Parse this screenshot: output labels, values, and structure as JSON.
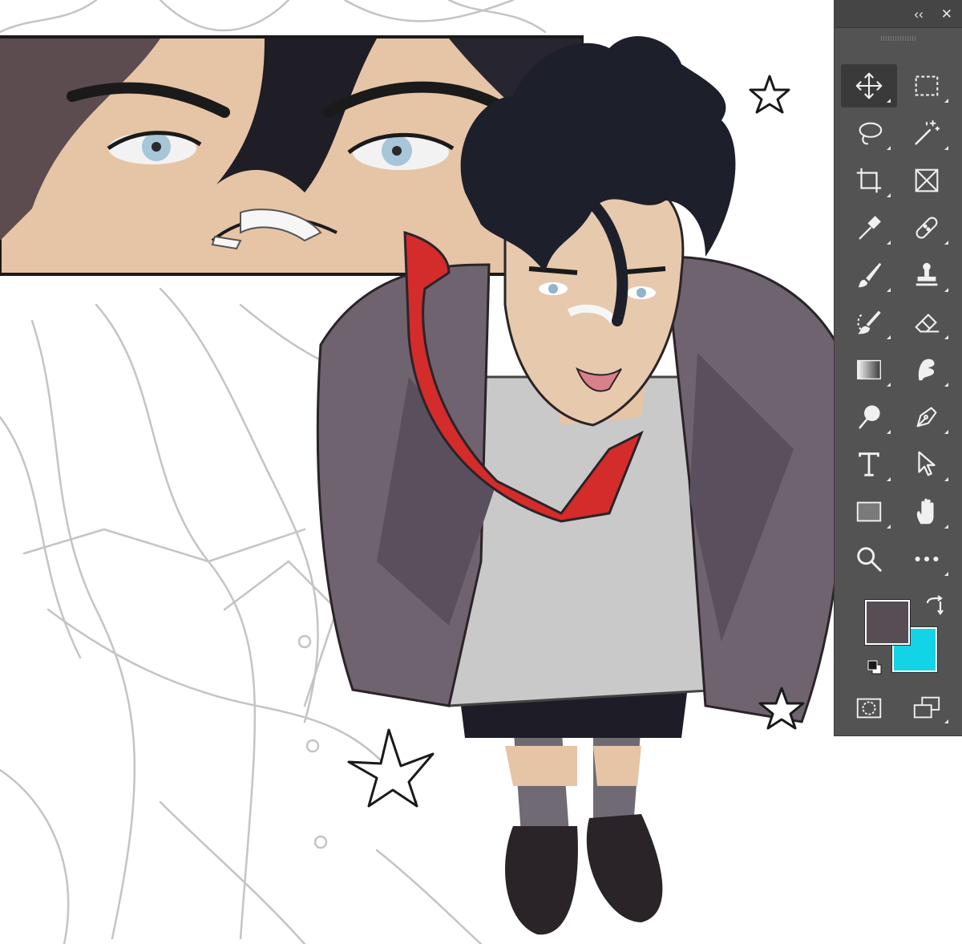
{
  "panel": {
    "header_buttons": [
      {
        "name": "collapse-panel-button",
        "glyph": "‹‹"
      },
      {
        "name": "close-panel-button",
        "glyph": "✕"
      }
    ],
    "tools": [
      {
        "name": "move-tool",
        "icon": "move-icon",
        "active": true
      },
      {
        "name": "marquee-tool",
        "icon": "rect-marquee-icon"
      },
      {
        "name": "lasso-tool",
        "icon": "lasso-icon"
      },
      {
        "name": "magic-wand-tool",
        "icon": "magic-wand-icon"
      },
      {
        "name": "crop-tool",
        "icon": "crop-icon"
      },
      {
        "name": "frame-tool",
        "icon": "frame-icon"
      },
      {
        "name": "eyedropper-tool",
        "icon": "eyedropper-icon"
      },
      {
        "name": "healing-brush-tool",
        "icon": "bandage-icon"
      },
      {
        "name": "brush-tool",
        "icon": "brush-icon"
      },
      {
        "name": "stamp-tool",
        "icon": "stamp-icon"
      },
      {
        "name": "history-brush-tool",
        "icon": "history-brush-icon"
      },
      {
        "name": "eraser-tool",
        "icon": "eraser-icon"
      },
      {
        "name": "gradient-tool",
        "icon": "gradient-icon"
      },
      {
        "name": "smudge-tool",
        "icon": "smudge-icon"
      },
      {
        "name": "dodge-tool",
        "icon": "dodge-icon"
      },
      {
        "name": "pen-tool",
        "icon": "pen-icon"
      },
      {
        "name": "type-tool",
        "icon": "type-icon"
      },
      {
        "name": "path-selection-tool",
        "icon": "arrow-cursor-icon"
      },
      {
        "name": "rectangle-tool",
        "icon": "rectangle-icon"
      },
      {
        "name": "hand-tool",
        "icon": "hand-icon"
      },
      {
        "name": "zoom-tool",
        "icon": "zoom-icon"
      },
      {
        "name": "more-tools",
        "icon": "ellipsis-icon"
      }
    ],
    "colors": {
      "panel_bg": "#535353",
      "foreground": "#564d55",
      "background": "#12d4e6"
    },
    "bottom_tools": [
      {
        "name": "quick-mask-button",
        "icon": "quick-mask-icon"
      },
      {
        "name": "screen-mode-button",
        "icon": "screen-mode-icon"
      }
    ]
  },
  "canvas": {
    "tie_color": "#d42b2b",
    "jacket_color": "#6f6370",
    "shirt_color": "#c9c9c9",
    "skin_color": "#e7c9ad",
    "hair_color": "#1d1f2b"
  }
}
